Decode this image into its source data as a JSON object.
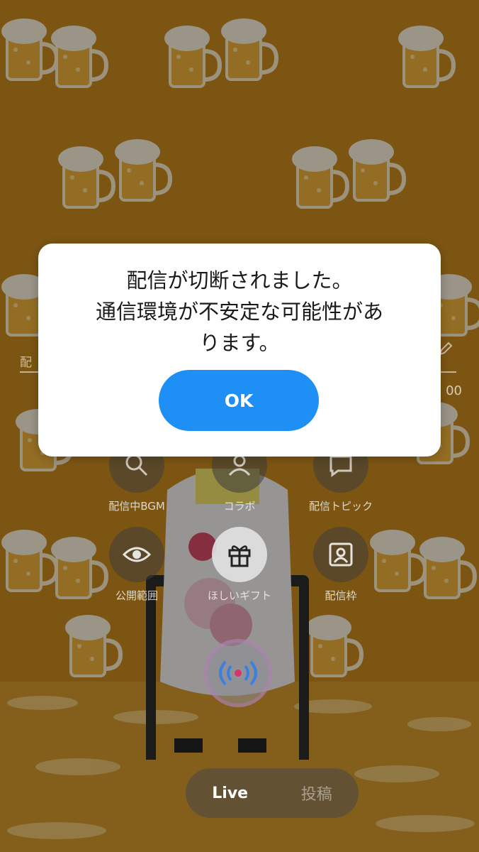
{
  "dialog": {
    "message_lines": [
      "配信が切断されました。",
      "通信環境が不安定な可能性があ",
      "ります。"
    ],
    "ok_label": "OK",
    "button_color": "#1e90f5"
  },
  "underlay": {
    "title_field_label": "配",
    "char_counter": "00",
    "tools": [
      {
        "icon": "music-search-icon",
        "label": "配信中BGM"
      },
      {
        "icon": "person-icon",
        "label": "コラボ"
      },
      {
        "icon": "chat-bubble-icon",
        "label": "配信トピック"
      },
      {
        "icon": "eye-icon",
        "label": "公開範囲"
      },
      {
        "icon": "gift-icon",
        "label": "ほしいギフト"
      },
      {
        "icon": "portrait-frame-icon",
        "label": "配信枠"
      }
    ],
    "live_button_icon": "broadcast-icon",
    "tabs": [
      {
        "label": "Live",
        "active": true
      },
      {
        "label": "投稿",
        "active": false
      }
    ]
  },
  "background": {
    "pattern": "beer-mug-icon",
    "color": "#a06a16"
  }
}
